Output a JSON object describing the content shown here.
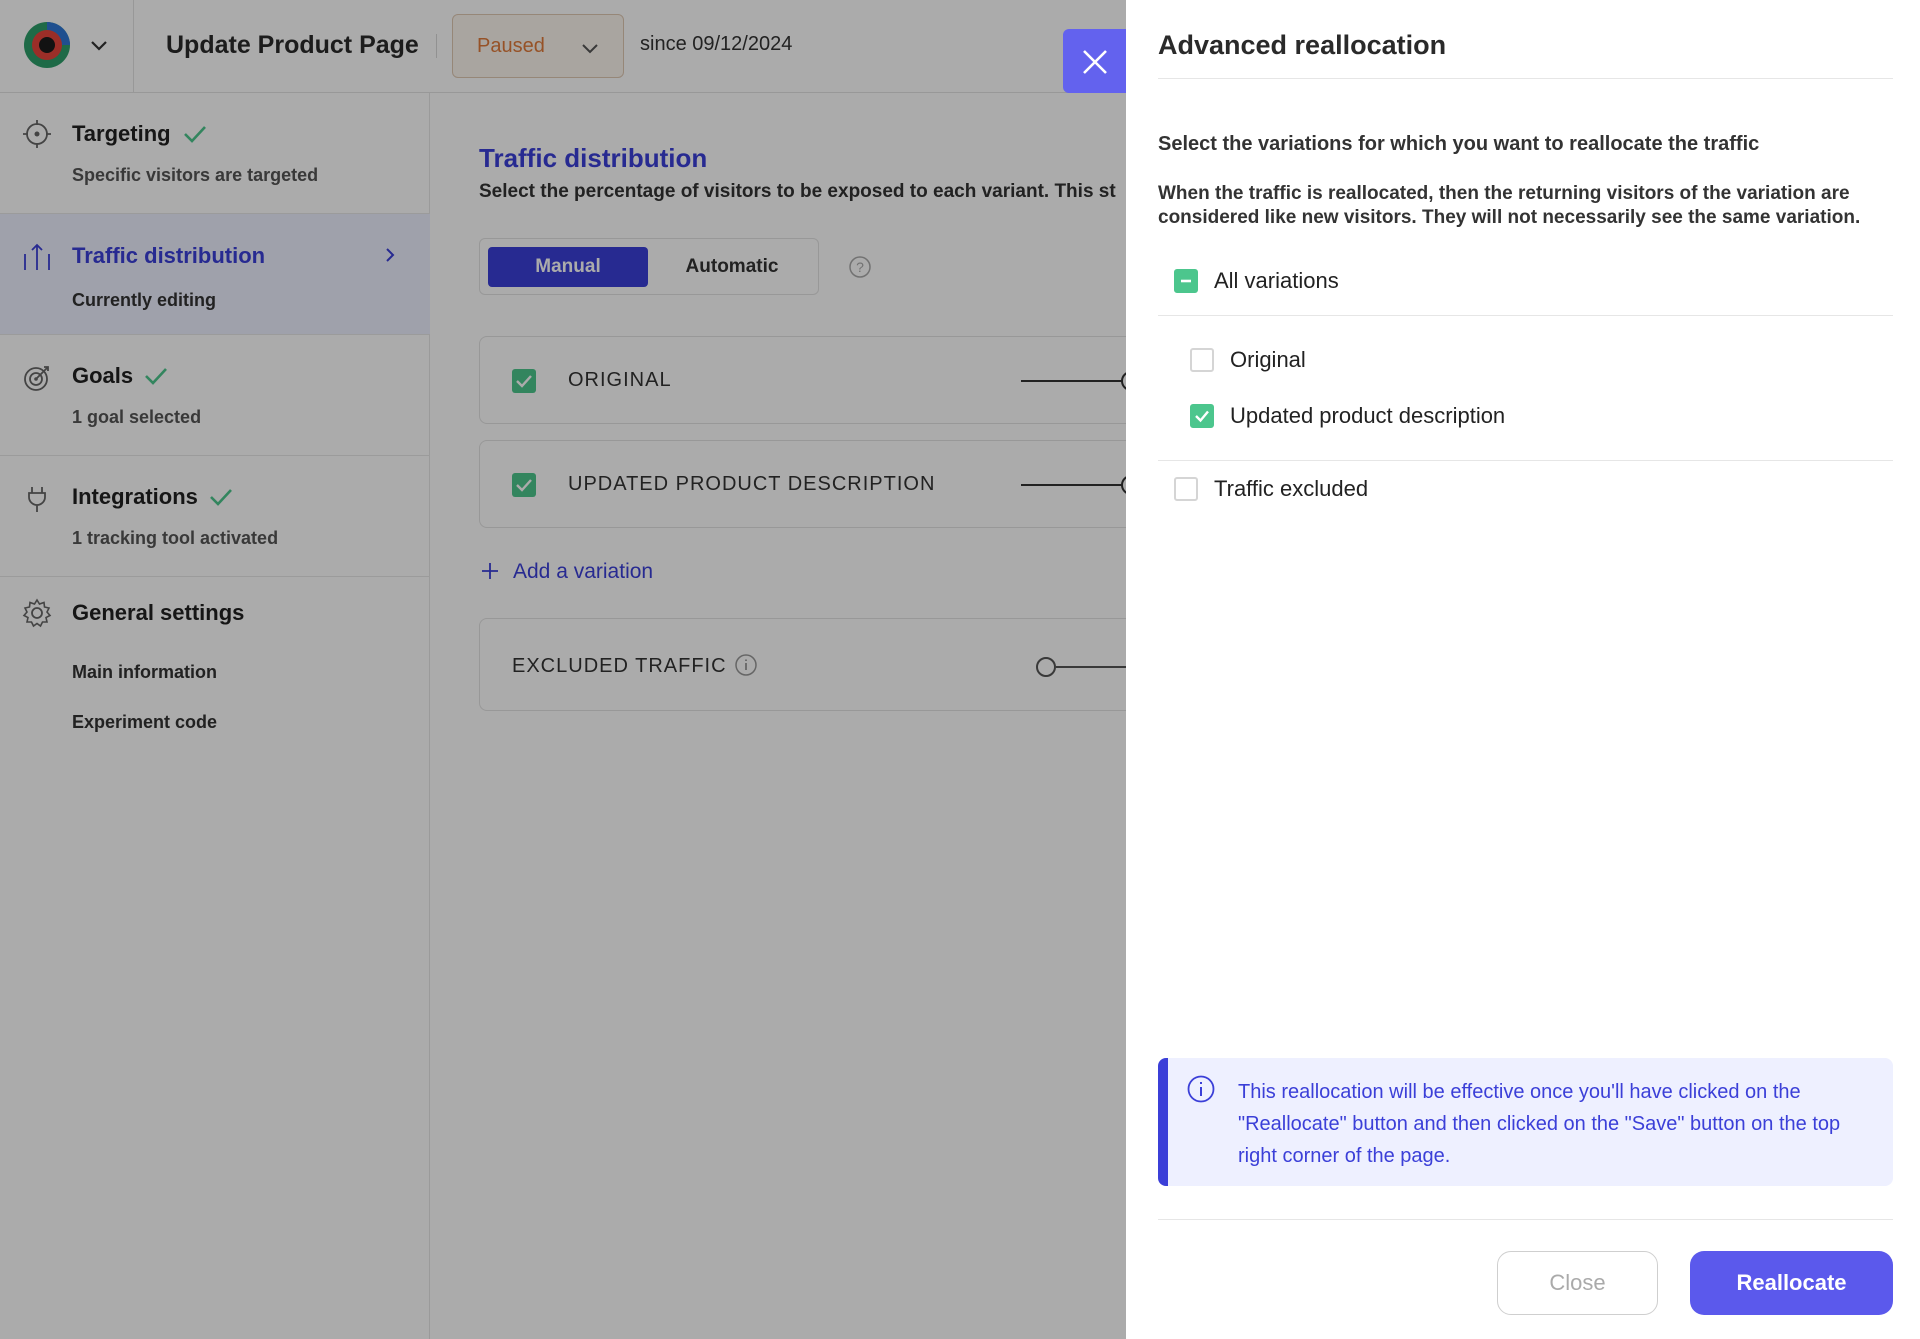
{
  "header": {
    "page_title": "Update Product Page",
    "status": "Paused",
    "since": "since 09/12/2024"
  },
  "sidebar": {
    "items": [
      {
        "title": "Targeting",
        "subtitle": "Specific visitors are targeted",
        "icon": "crosshair-icon",
        "done": true
      },
      {
        "title": "Traffic distribution",
        "subtitle": "Currently editing",
        "icon": "traffic-icon",
        "active": true
      },
      {
        "title": "Goals",
        "subtitle": "1 goal selected",
        "icon": "target-icon",
        "done": true
      },
      {
        "title": "Integrations",
        "subtitle": "1 tracking tool activated",
        "icon": "plug-icon",
        "done": true
      },
      {
        "title": "General settings",
        "icon": "gear-icon"
      }
    ],
    "settings_links": [
      "Main information",
      "Experiment code"
    ]
  },
  "main": {
    "title": "Traffic distribution",
    "description": "Select the percentage of visitors to be exposed to each variant. This st",
    "modes": [
      "Manual",
      "Automatic"
    ],
    "selected_mode": "Manual",
    "variations": [
      "ORIGINAL",
      "UPDATED PRODUCT DESCRIPTION"
    ],
    "add_variation": "Add a variation",
    "excluded_traffic": "EXCLUDED TRAFFIC"
  },
  "drawer": {
    "title": "Advanced reallocation",
    "heading": "Select the variations for which you want to reallocate the traffic",
    "note": "When the traffic is reallocated, then the returning visitors of the variation are considered like new visitors. They will not necessarily see the same variation.",
    "all_variations": {
      "label": "All variations",
      "state": "partial"
    },
    "options": [
      {
        "label": "Original",
        "checked": false
      },
      {
        "label": "Updated product description",
        "checked": true
      }
    ],
    "traffic_excluded": {
      "label": "Traffic excluded",
      "checked": false
    },
    "info": "This reallocation will be effective once you'll have clicked on the \"Reallocate\" button and then clicked on the \"Save\" button on the top right corner of the page.",
    "close_label": "Close",
    "reallocate_label": "Reallocate"
  },
  "colors": {
    "accent": "#3b3fd8",
    "button": "#5b59ec",
    "check": "#4cc68d",
    "paused": "#e07b3b"
  }
}
